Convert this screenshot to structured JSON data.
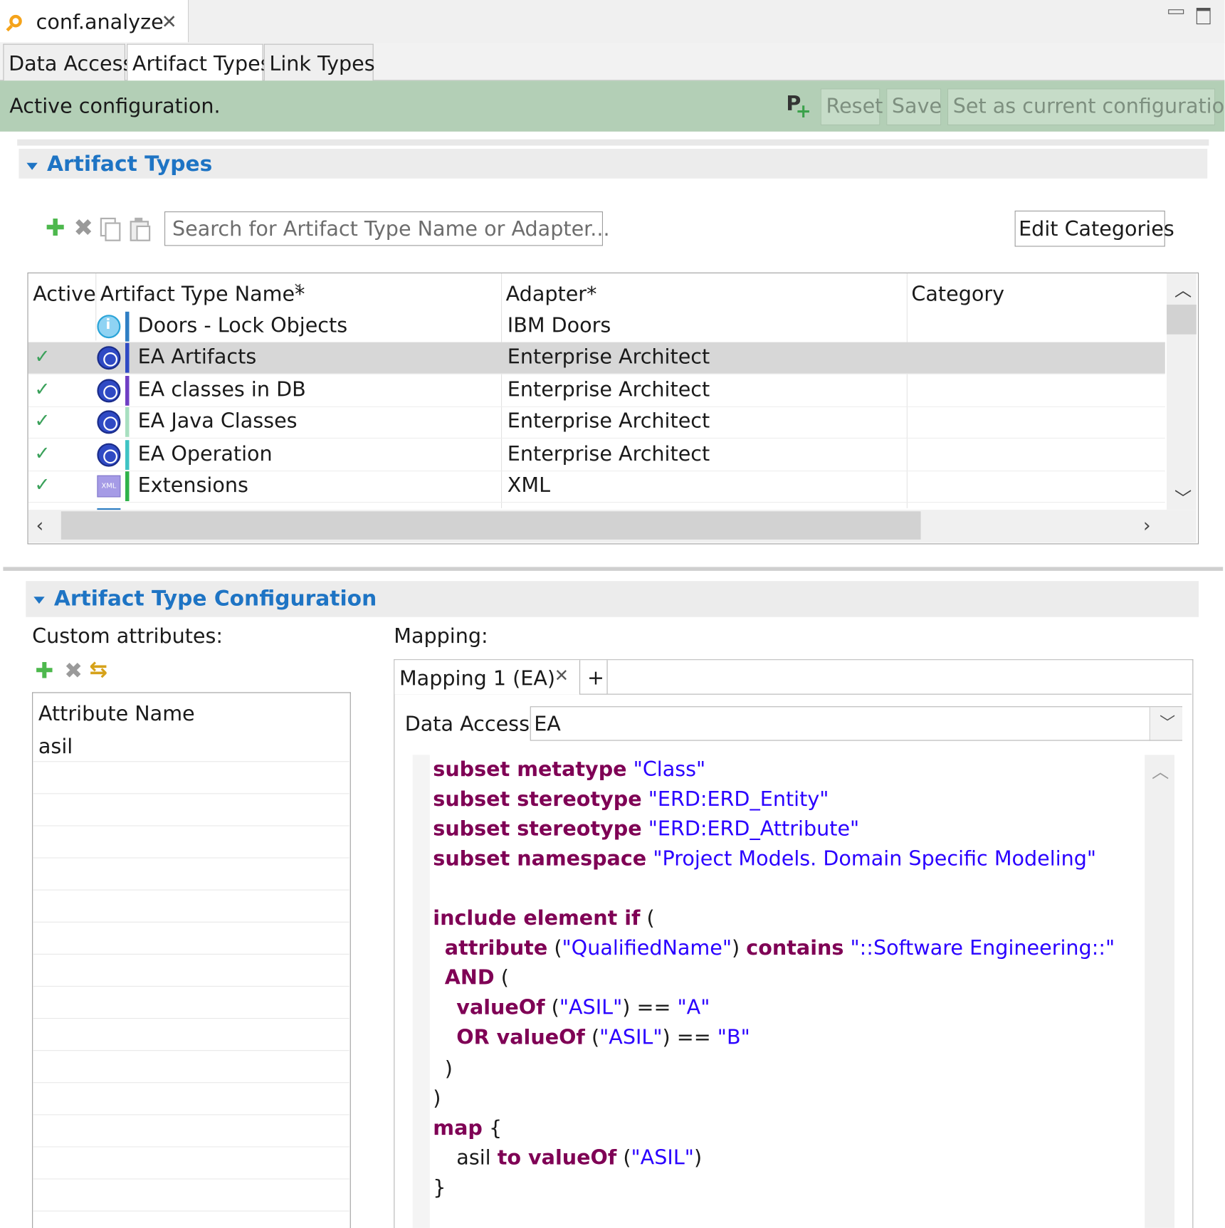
{
  "editor": {
    "tab_title": "conf.analyze",
    "minimize_icon": "minimize-icon",
    "maximize_icon": "maximize-icon"
  },
  "subtabs": [
    "Data Access",
    "Artifact Types",
    "Link Types"
  ],
  "status": {
    "message": "Active configuration.",
    "reset_label": "Reset",
    "save_label": "Save",
    "set_current_label": "Set as current configuration"
  },
  "artifact_types": {
    "section_title": "Artifact Types",
    "search_placeholder": "Search for Artifact Type Name or Adapter...",
    "edit_categories_label": "Edit Categories",
    "columns": [
      "Active",
      "Artifact Type Name*",
      "Adapter*",
      "Category"
    ],
    "rows": [
      {
        "active": "",
        "name": "Doors - Lock Objects",
        "adapter": "IBM Doors",
        "category": "",
        "icon": "doors-icon",
        "color": "#2f7fc4"
      },
      {
        "active": "✓",
        "name": "EA Artifacts",
        "adapter": "Enterprise Architect",
        "category": "",
        "icon": "ea-icon",
        "color": "#2f4ac4"
      },
      {
        "active": "✓",
        "name": "EA classes in DB",
        "adapter": "Enterprise Architect",
        "category": "",
        "icon": "ea-icon",
        "color": "#6f3fc4"
      },
      {
        "active": "✓",
        "name": "EA Java Classes",
        "adapter": "Enterprise Architect",
        "category": "",
        "icon": "ea-icon",
        "color": "#a8dfc0"
      },
      {
        "active": "✓",
        "name": "EA Operation",
        "adapter": "Enterprise Architect",
        "category": "",
        "icon": "ea-icon",
        "color": "#3fc4c4"
      },
      {
        "active": "✓",
        "name": "Extensions",
        "adapter": "XML",
        "category": "",
        "icon": "xml-icon",
        "color": "#2fb34a"
      }
    ],
    "xml_icon_text": "XML"
  },
  "configuration": {
    "section_title": "Artifact Type Configuration",
    "custom_attributes_label": "Custom attributes:",
    "attribute_header": "Attribute Name",
    "attributes": [
      "asil"
    ],
    "mapping_label": "Mapping:",
    "mapping_tab_label": "Mapping 1 (EA)",
    "add_tab_label": "+",
    "data_access_label": "Data Access:",
    "data_access_value": "EA"
  },
  "code": {
    "l1_kw": "subset metatype",
    "l1_str": "\"Class\"",
    "l2_kw": "subset stereotype",
    "l2_str": "\"ERD:ERD_Entity\"",
    "l3_kw": "subset stereotype",
    "l3_str": "\"ERD:ERD_Attribute\"",
    "l4_kw": "subset namespace",
    "l4_str": "\"Project Models. Domain Specific Modeling\"",
    "l5_kw": "include element if",
    "l5_pl": "(",
    "l6_kw": "attribute",
    "l6_pl": "(",
    "l6_str": "\"QualifiedName\"",
    "l6_pl2": ")",
    "l6_kw2": "contains",
    "l6_str2": "\"::Software Engineering::\"",
    "l7_kw": "AND",
    "l7_pl": "(",
    "l8_kw": "valueOf",
    "l8_pl": "(",
    "l8_str": "\"ASIL\"",
    "l8_pl2": ") ==",
    "l8_str2": "\"A\"",
    "l9_kw": "OR valueOf",
    "l9_pl": "(",
    "l9_str": "\"ASIL\"",
    "l9_pl2": ") ==",
    "l9_str2": "\"B\"",
    "l10_pl": ")",
    "l11_pl": ")",
    "l12_kw": "map",
    "l12_pl": "{",
    "l13_pl": "asil",
    "l13_kw": "to valueOf",
    "l13_pl2": "(",
    "l13_str": "\"ASIL\"",
    "l13_pl3": ")",
    "l14_pl": "}"
  }
}
